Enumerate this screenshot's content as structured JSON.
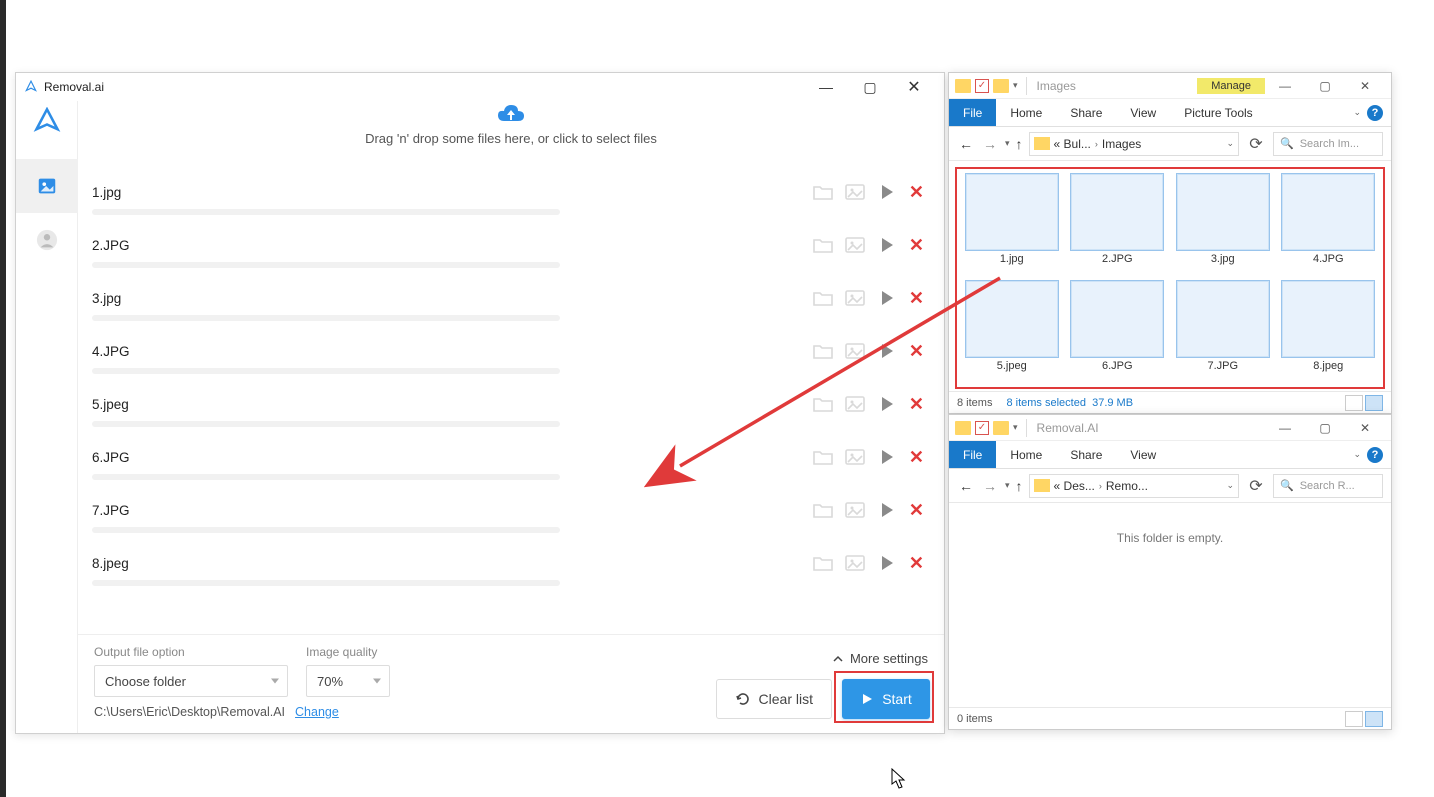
{
  "app": {
    "title": "Removal.ai",
    "drop_text": "Drag 'n' drop some files here, or click to select files",
    "files": [
      "1.jpg",
      "2.JPG",
      "3.jpg",
      "4.JPG",
      "5.jpeg",
      "6.JPG",
      "7.JPG",
      "8.jpeg"
    ],
    "footer": {
      "output_label": "Output file option",
      "output_value": "Choose folder",
      "quality_label": "Image quality",
      "quality_value": "70%",
      "more_settings": "More settings",
      "path": "C:\\Users\\Eric\\Desktop\\Removal.AI",
      "change": "Change",
      "clear": "Clear list",
      "start": "Start"
    }
  },
  "explorer1": {
    "title": "Images",
    "manage": "Manage",
    "tabs": {
      "file": "File",
      "home": "Home",
      "share": "Share",
      "view": "View",
      "tools": "Picture Tools"
    },
    "bread": {
      "p1": "« Bul...",
      "p2": "Images"
    },
    "search_ph": "Search Im...",
    "thumbs": [
      "1.jpg",
      "2.JPG",
      "3.jpg",
      "4.JPG",
      "5.jpeg",
      "6.JPG",
      "7.JPG",
      "8.jpeg"
    ],
    "status": {
      "count": "8 items",
      "sel": "8 items selected",
      "size": "37.9 MB"
    }
  },
  "explorer2": {
    "title": "Removal.AI",
    "tabs": {
      "file": "File",
      "home": "Home",
      "share": "Share",
      "view": "View"
    },
    "bread": {
      "p1": "« Des...",
      "p2": "Remo..."
    },
    "search_ph": "Search R...",
    "empty": "This folder is empty.",
    "status": {
      "count": "0 items"
    }
  }
}
